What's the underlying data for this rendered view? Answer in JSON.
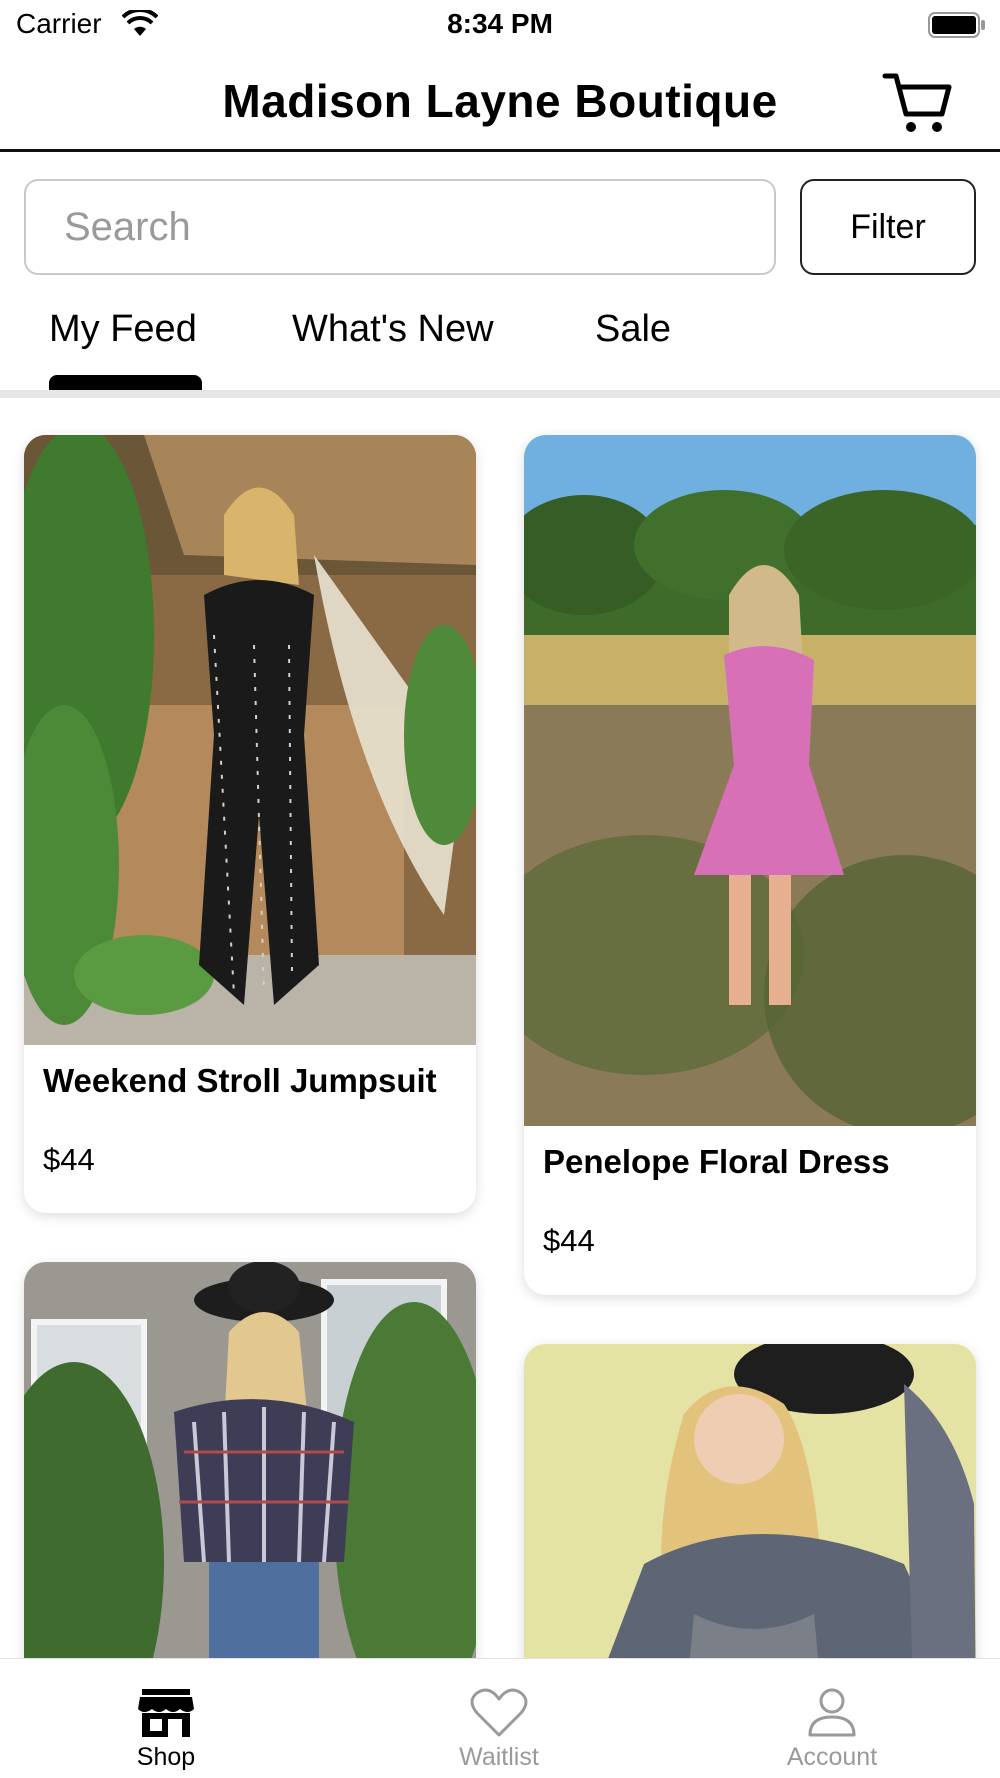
{
  "status_bar": {
    "carrier": "Carrier",
    "time": "8:34 PM"
  },
  "nav": {
    "title": "Madison Layne Boutique",
    "cart_icon": "cart-icon"
  },
  "search": {
    "placeholder": "Search",
    "value": "",
    "filter_label": "Filter"
  },
  "tabs": [
    {
      "label": "My Feed",
      "selected": true
    },
    {
      "label": "What's New",
      "selected": false
    },
    {
      "label": "Sale",
      "selected": false
    }
  ],
  "products": [
    {
      "name": "Weekend Stroll Jumpsuit",
      "price": "$44"
    },
    {
      "name": "Penelope Floral Dress",
      "price": "$44"
    },
    {
      "name": "",
      "price": ""
    },
    {
      "name": "",
      "price": ""
    }
  ],
  "tab_bar": [
    {
      "label": "Shop",
      "icon": "store-icon",
      "selected": true
    },
    {
      "label": "Waitlist",
      "icon": "heart-icon",
      "selected": false
    },
    {
      "label": "Account",
      "icon": "person-icon",
      "selected": false
    }
  ],
  "colors": {
    "active": "#000000",
    "inactive": "#9a9a9a",
    "divider": "#e6e6e6"
  }
}
